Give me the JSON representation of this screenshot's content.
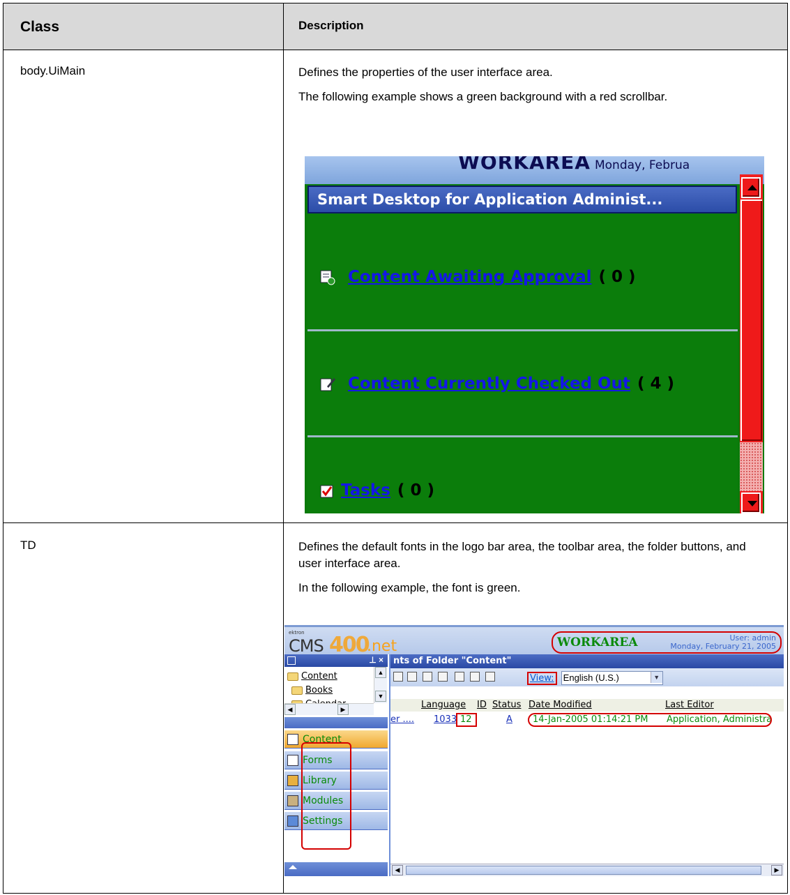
{
  "table": {
    "header": {
      "class": "Class",
      "description": "Description"
    },
    "rows": [
      {
        "class": "body.UiMain",
        "description": [
          "Defines the properties of the user interface area.",
          "The following example shows a green background with a red scrollbar."
        ],
        "screenshot": {
          "workarea_title": "WORKAREA",
          "workarea_date": "Monday, Februa",
          "panel_title": "Smart Desktop for Application Administ...",
          "items": [
            {
              "label": "Content Awaiting Approval",
              "count": "( 0 )",
              "icon": "approval-icon"
            },
            {
              "label": "Content Currently Checked Out",
              "count": "( 4 )",
              "icon": "checkout-icon"
            },
            {
              "label": "Tasks",
              "count": "( 0 )",
              "icon": "tasks-icon"
            }
          ],
          "colors": {
            "background": "#0b7d0b",
            "scrollbar": "#f02020",
            "link": "#1416e8"
          }
        }
      },
      {
        "class": "TD",
        "description": [
          "Defines the default fonts in the logo bar area, the toolbar area, the folder buttons, and user interface area.",
          "In the following example, the font is green."
        ],
        "screenshot": {
          "logo": {
            "small": "ektron",
            "cms": "CMS",
            "num": "400",
            "net": ".net"
          },
          "workarea_title": "WORKAREA",
          "user": "User: admin",
          "date": "Monday, February 21, 2005",
          "tree": [
            "Content",
            "Books",
            "Calendar"
          ],
          "folder_buttons": [
            "Content",
            "Forms",
            "Library",
            "Modules",
            "Settings"
          ],
          "content_title": "nts of Folder \"Content\"",
          "view_label": "View:",
          "language_select": "English (U.S.)",
          "columns": [
            "Language",
            "ID",
            "Status",
            "Date Modified",
            "Last Editor"
          ],
          "row": {
            "title": "er ....",
            "language": "1033",
            "id": "12",
            "status": "A",
            "date_modified": "14-Jan-2005 01:14:21 PM",
            "last_editor": "Application, Administra"
          },
          "colors": {
            "font": "#0a8a0a",
            "highlight": "#d40000"
          }
        }
      }
    ]
  }
}
